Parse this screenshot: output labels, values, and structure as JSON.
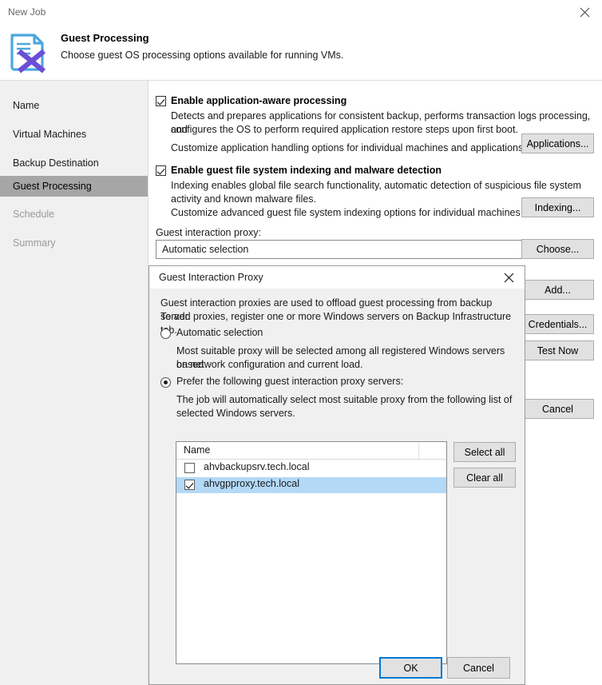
{
  "window": {
    "title": "New Job",
    "close_icon": "close-icon"
  },
  "header": {
    "icon": "document-guest-processing-icon",
    "title": "Guest Processing",
    "subtitle": "Choose guest OS processing options available for running VMs."
  },
  "sidebar": {
    "items": [
      {
        "label": "Name",
        "state": "normal"
      },
      {
        "label": "Virtual Machines",
        "state": "normal"
      },
      {
        "label": "Backup Destination",
        "state": "normal"
      },
      {
        "label": "Guest Processing",
        "state": "active"
      },
      {
        "label": "Schedule",
        "state": "disabled"
      },
      {
        "label": "Summary",
        "state": "disabled"
      }
    ]
  },
  "main": {
    "app_aware": {
      "checked": true,
      "label": "Enable application-aware processing",
      "desc_line1": "Detects and prepares applications for consistent backup, performs transaction logs processing, and",
      "desc_line2": "configures the OS to perform required application restore steps upon first boot.",
      "hint": "Customize application handling options for individual machines and applications",
      "button": "Applications..."
    },
    "indexing": {
      "checked": true,
      "label": "Enable guest file system indexing and malware detection",
      "desc_line1": "Indexing enables global file search functionality, automatic detection of suspicious file system",
      "desc_line2": "activity and known malware files.",
      "hint": "Customize advanced guest file system indexing options for individual machines",
      "button": "Indexing..."
    },
    "proxy": {
      "label": "Guest interaction proxy:",
      "value": "Automatic selection",
      "button": "Choose..."
    },
    "side_buttons": [
      {
        "label": "Add..."
      },
      {
        "label": "Credentials..."
      },
      {
        "label": "Test Now"
      }
    ],
    "cancel_button": "Cancel"
  },
  "dialog": {
    "title": "Guest Interaction Proxy",
    "close_icon": "close-icon",
    "intro_line1": "Guest interaction proxies are used to offload guest processing from backup server.",
    "intro_line2": "To add proxies, register one or more Windows servers on Backup Infrastructure tab.",
    "option_automatic": {
      "selected": false,
      "label": "Automatic selection",
      "desc_line1": "Most suitable proxy will be selected among all registered Windows servers based",
      "desc_line2": "on network configuration and current load."
    },
    "option_prefer": {
      "selected": true,
      "label": "Prefer the following guest interaction proxy servers:",
      "desc_line1": "The job will automatically select most suitable proxy from the following list of",
      "desc_line2": "selected Windows servers."
    },
    "list": {
      "column_header": "Name",
      "rows": [
        {
          "name": "ahvbackupsrv.tech.local",
          "checked": false,
          "selected": false
        },
        {
          "name": "ahvgpproxy.tech.local",
          "checked": true,
          "selected": true
        }
      ]
    },
    "list_buttons": [
      {
        "label": "Select all"
      },
      {
        "label": "Clear all"
      }
    ],
    "ok_button": "OK",
    "cancel_button": "Cancel"
  },
  "colors": {
    "accent": "#0078d7",
    "selection": "#b3d9f7",
    "nav_active": "#a6a6a6",
    "panel": "#f0f0f0",
    "icon_blue": "#4aa8dd",
    "icon_purple": "#6b4fd8"
  }
}
